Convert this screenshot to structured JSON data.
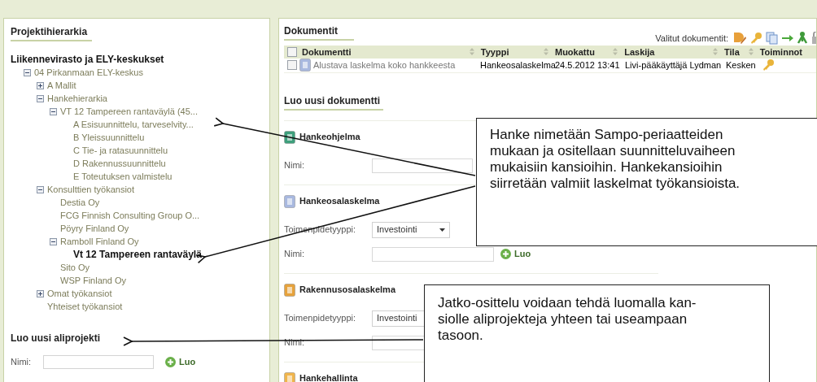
{
  "project_panel": {
    "title": "Projektihierarkia",
    "tree": {
      "label": "Liikennevirasto ja ELY-keskukset",
      "kind": "root",
      "selected": false,
      "children": [
        {
          "label": "04 Pirkanmaan ELY-keskus",
          "kind": "folder",
          "expanded": true,
          "selected": false,
          "children": [
            {
              "label": "A Mallit",
              "kind": "folder",
              "expanded": false,
              "selected": false
            },
            {
              "label": "Hankehierarkia",
              "kind": "folder",
              "expanded": true,
              "selected": false,
              "children": [
                {
                  "label": "VT 12 Tampereen rantaväylä (45...",
                  "kind": "folder",
                  "expanded": true,
                  "selected": false,
                  "children": [
                    {
                      "label": "A Esisuunnittelu, tarveselvity...",
                      "kind": "leaf",
                      "selected": false
                    },
                    {
                      "label": "B Yleissuunnittelu",
                      "kind": "leaf",
                      "selected": false
                    },
                    {
                      "label": "C Tie- ja ratasuunnittelu",
                      "kind": "leaf",
                      "selected": false
                    },
                    {
                      "label": "D Rakennussuunnittelu",
                      "kind": "leaf",
                      "selected": false
                    },
                    {
                      "label": "E Toteutuksen valmistelu",
                      "kind": "leaf",
                      "selected": false
                    }
                  ]
                }
              ]
            },
            {
              "label": "Konsulttien työkansiot",
              "kind": "folder",
              "expanded": true,
              "selected": false,
              "children": [
                {
                  "label": "Destia Oy",
                  "kind": "leaf",
                  "selected": false
                },
                {
                  "label": "FCG Finnish Consulting Group O...",
                  "kind": "leaf",
                  "selected": false
                },
                {
                  "label": "Pöyry Finland Oy",
                  "kind": "leaf",
                  "selected": false
                },
                {
                  "label": "Ramboll Finland Oy",
                  "kind": "folder",
                  "expanded": true,
                  "selected": false,
                  "children": [
                    {
                      "label": "Vt 12 Tampereen rantaväylä",
                      "kind": "leaf",
                      "selected": true
                    }
                  ]
                },
                {
                  "label": "Sito Oy",
                  "kind": "leaf",
                  "selected": false
                },
                {
                  "label": "WSP Finland Oy",
                  "kind": "leaf",
                  "selected": false
                }
              ]
            },
            {
              "label": "Omat työkansiot",
              "kind": "folder",
              "expanded": false,
              "selected": false
            },
            {
              "label": "Yhteiset työkansiot",
              "kind": "leaf",
              "selected": false
            }
          ]
        }
      ]
    },
    "create_subproject": {
      "title": "Luo uusi aliprojekti",
      "name_label": "Nimi:",
      "button": "Luo"
    }
  },
  "documents_panel": {
    "title": "Dokumentit",
    "selected_actions_label": "Valitut dokumentit:",
    "table": {
      "header_checked": false,
      "columns": [
        {
          "label": "Dokumentti",
          "sortable": true
        },
        {
          "label": "Tyyppi",
          "sortable": true
        },
        {
          "label": "Muokattu",
          "sortable": true
        },
        {
          "label": "Laskija",
          "sortable": true
        },
        {
          "label": "Tila",
          "sortable": true
        },
        {
          "label": "Toiminnot",
          "sortable": false
        }
      ],
      "rows": [
        {
          "checked": false,
          "name": "Alustava laskelma koko hankkeesta",
          "type": "Hankeosalaskelma",
          "modified": "24.5.2012 13:41",
          "calculator": "Livi-pääkäyttäjä Lydman",
          "status": "Kesken"
        }
      ]
    }
  },
  "create_document": {
    "title": "Luo uusi dokumentti",
    "sections": [
      {
        "title": "Hankeohjelma",
        "color": "#3e9f7c",
        "fields": [
          {
            "kind": "text",
            "label": "Nimi:"
          }
        ]
      },
      {
        "title": "Hankeosalaskelma",
        "color": "#a8b8df",
        "fields": [
          {
            "kind": "select",
            "label": "Toimenpidetyyppi:",
            "value": "Investointi"
          },
          {
            "kind": "text",
            "label": "Nimi:",
            "button": "Luo"
          }
        ]
      },
      {
        "title": "Rakennusosalaskelma",
        "color": "#e6a23c",
        "fields": [
          {
            "kind": "select",
            "label": "Toimenpidetyyppi:",
            "value": "Investointi"
          },
          {
            "kind": "text",
            "label": "Nimi:"
          }
        ]
      },
      {
        "title": "Hankehallinta",
        "color": "#f0b54c"
      }
    ]
  },
  "callouts": [
    {
      "lines": [
        "Hanke nimetään Sampo-periaatteiden",
        "mukaan ja ositellaan suunnitteluvaiheen",
        "mukaisiin kansioihin. Hankekansioihin",
        "siirretään valmiit laskelmat työkansioista."
      ]
    },
    {
      "lines": [
        "Jatko-osittelu voidaan tehdä luomalla kan-",
        "siolle aliprojekteja yhteen tai useampaan",
        "tasoon."
      ]
    }
  ]
}
